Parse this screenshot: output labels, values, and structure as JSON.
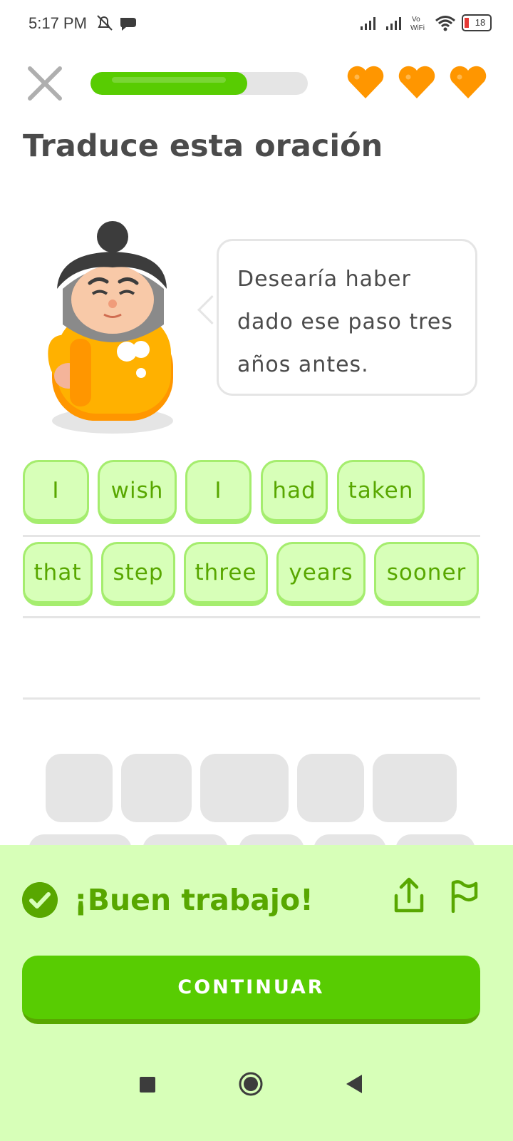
{
  "status_bar": {
    "time": "5:17 PM",
    "battery": "18",
    "icons": [
      "mute-icon",
      "chat-bubble-icon",
      "signal-icon",
      "signal-icon",
      "vowifi-icon",
      "wifi-icon",
      "battery-icon"
    ]
  },
  "header": {
    "progress_fraction": 0.72,
    "hearts_count": 3
  },
  "title": "Traduce esta oración",
  "prompt": {
    "text": "Desearía haber dado ese paso tres años antes."
  },
  "answer": {
    "row1": [
      "I",
      "wish",
      "I",
      "had",
      "taken"
    ],
    "row2": [
      "that",
      "step",
      "three",
      "years",
      "sooner"
    ]
  },
  "feedback": {
    "title": "¡Buen trabajo!",
    "continue_label": "CONTINUAR"
  },
  "colors": {
    "green": "#58cc02",
    "dark_green": "#58a700",
    "light_green": "#d7ffb8",
    "chip_border": "#a5ed6e",
    "heart": "#ff9600",
    "gray": "#e5e5e5"
  }
}
